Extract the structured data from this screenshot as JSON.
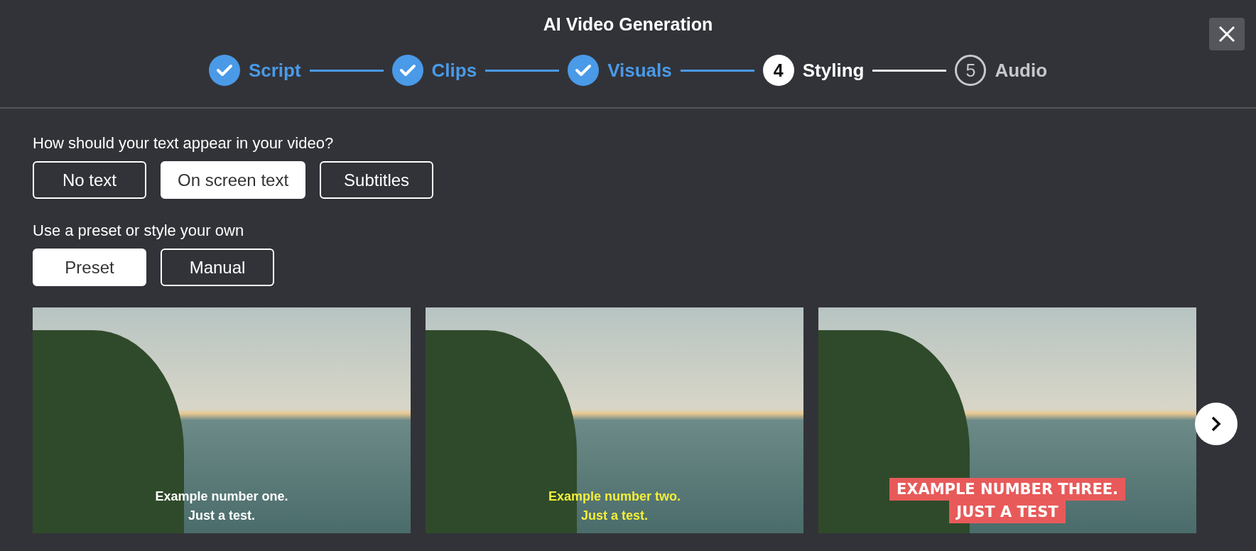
{
  "title": "AI Video Generation",
  "steps": [
    {
      "label": "Script",
      "kind": "done"
    },
    {
      "label": "Clips",
      "kind": "done"
    },
    {
      "label": "Visuals",
      "kind": "done"
    },
    {
      "label": "Styling",
      "number": "4",
      "kind": "current"
    },
    {
      "label": "Audio",
      "number": "5",
      "kind": "upcoming"
    }
  ],
  "text_question": "How should your text appear in your video?",
  "text_options": [
    {
      "label": "No text",
      "selected": false
    },
    {
      "label": "On screen text",
      "selected": true
    },
    {
      "label": "Subtitles",
      "selected": false
    }
  ],
  "style_question": "Use a preset or style your own",
  "style_options": [
    {
      "label": "Preset",
      "selected": true
    },
    {
      "label": "Manual",
      "selected": false
    }
  ],
  "presets": [
    {
      "kind": "plain",
      "lines": [
        "Example number one.",
        "Just a test."
      ]
    },
    {
      "kind": "yellow",
      "lines": [
        "Example number two.",
        "Just a test."
      ]
    },
    {
      "kind": "boxed",
      "lines": [
        "EXAMPLE NUMBER THREE.",
        "JUST A TEST"
      ]
    }
  ]
}
